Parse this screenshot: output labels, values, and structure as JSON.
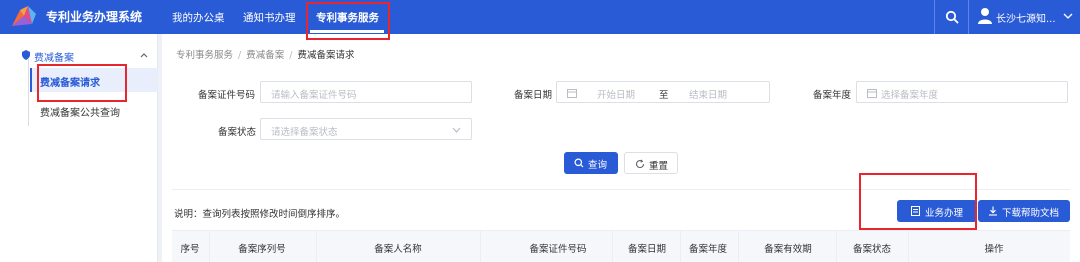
{
  "header": {
    "app_title": "专利业务办理系统",
    "nav": [
      "我的办公桌",
      "通知书办理",
      "专利事务服务"
    ],
    "active_nav_index": 2,
    "user_name": "长沙七源知...",
    "brand_color": "#2a5bd7"
  },
  "sidebar": {
    "group_label": "费减备案",
    "items": [
      {
        "label": "费减备案请求",
        "active": true
      },
      {
        "label": "费减备案公共查询",
        "active": false
      }
    ]
  },
  "breadcrumb": [
    "专利事务服务",
    "费减备案",
    "费减备案请求"
  ],
  "filters": {
    "cert_no_label": "备案证件号码",
    "cert_no_placeholder": "请输入备案证件号码",
    "date_label": "备案日期",
    "date_start_placeholder": "开始日期",
    "date_range_sep": "至",
    "date_end_placeholder": "结束日期",
    "year_label": "备案年度",
    "year_placeholder": "选择备案年度",
    "status_label": "备案状态",
    "status_placeholder": "请选择备案状态",
    "search_button": "查询",
    "reset_button": "重置"
  },
  "note": "说明：查询列表按照修改时间倒序排序。",
  "actions": {
    "handle_button": "业务办理",
    "download_button": "下载帮助文档"
  },
  "table": {
    "columns": [
      "序号",
      "备案序列号",
      "备案人名称",
      "备案证件号码",
      "备案日期",
      "备案年度",
      "备案有效期",
      "备案状态",
      "操作"
    ]
  },
  "highlight_color": "#e8262d"
}
